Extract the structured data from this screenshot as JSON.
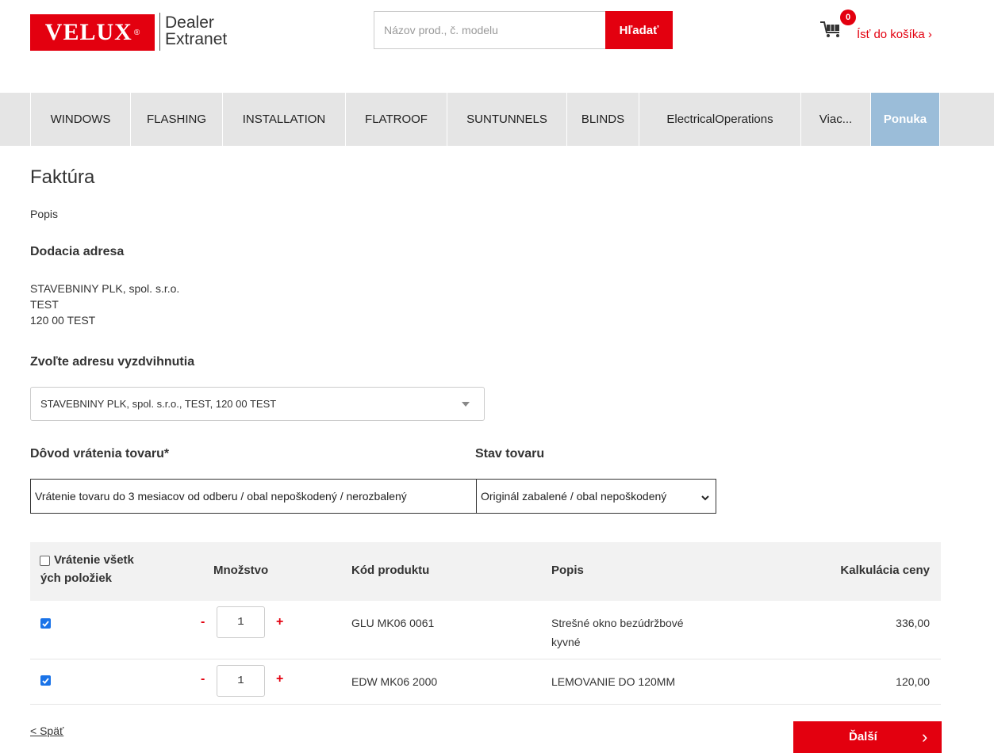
{
  "header": {
    "logo_text": "VELUX",
    "logo_line1": "Dealer",
    "logo_line2": "Extranet",
    "search_placeholder": "Názov prod., č. modelu",
    "search_button": "Hľadať",
    "cart_count": "0",
    "cart_link": "Ísť do košíka ›"
  },
  "nav": {
    "items": [
      {
        "label": "WINDOWS"
      },
      {
        "label": "FLASHING"
      },
      {
        "label": "INSTALLATION"
      },
      {
        "label": "FLATROOF"
      },
      {
        "label": "SUNTUNNELS"
      },
      {
        "label": "BLINDS"
      },
      {
        "label": "ElectricalOperations"
      },
      {
        "label": "Viac..."
      },
      {
        "label": "Ponuka"
      }
    ]
  },
  "main": {
    "title": "Faktúra",
    "popis": "Popis",
    "delivery_heading": "Dodacia adresa",
    "delivery_address": [
      "STAVEBNINY PLK, spol. s.r.o.",
      "TEST",
      "120 00 TEST"
    ],
    "pickup_heading": "Zvoľte adresu vyzdvihnutia",
    "pickup_selected": "STAVEBNINY PLK, spol. s.r.o., TEST, 120 00 TEST",
    "reason_heading": "Dôvod vrátenia tovaru*",
    "reason_value": "Vrátenie tovaru do 3 mesiacov od odberu / obal nepoškodený / nerozbalený",
    "state_heading": "Stav tovaru",
    "state_value": "Originál zabalené / obal nepoškodený"
  },
  "table": {
    "headers": {
      "select_all_line1": "Vrátenie všetk",
      "select_all_line2": "ých položiek",
      "quantity": "Množstvo",
      "product_code": "Kód produktu",
      "description": "Popis",
      "price": "Kalkulácia ceny"
    },
    "rows": [
      {
        "checked": true,
        "minus": "-",
        "qty": "1",
        "plus": "+",
        "code": "GLU MK06 0061",
        "desc_line1": "Strešné okno bezúdržbové",
        "desc_line2": "kyvné",
        "price": "336,00"
      },
      {
        "checked": true,
        "minus": "-",
        "qty": "1",
        "plus": "+",
        "code": "EDW MK06 2000",
        "desc_line1": "LEMOVANIE DO 120MM",
        "desc_line2": "",
        "price": "120,00"
      }
    ]
  },
  "footer": {
    "back": "< Späť",
    "next": "Ďalší",
    "next_arrow": "›"
  },
  "colors": {
    "brand_red": "#e3000f",
    "nav_active": "#9bbdd9",
    "nav_bg": "#e5e5e5",
    "checkbox_blue": "#1a73e8"
  }
}
